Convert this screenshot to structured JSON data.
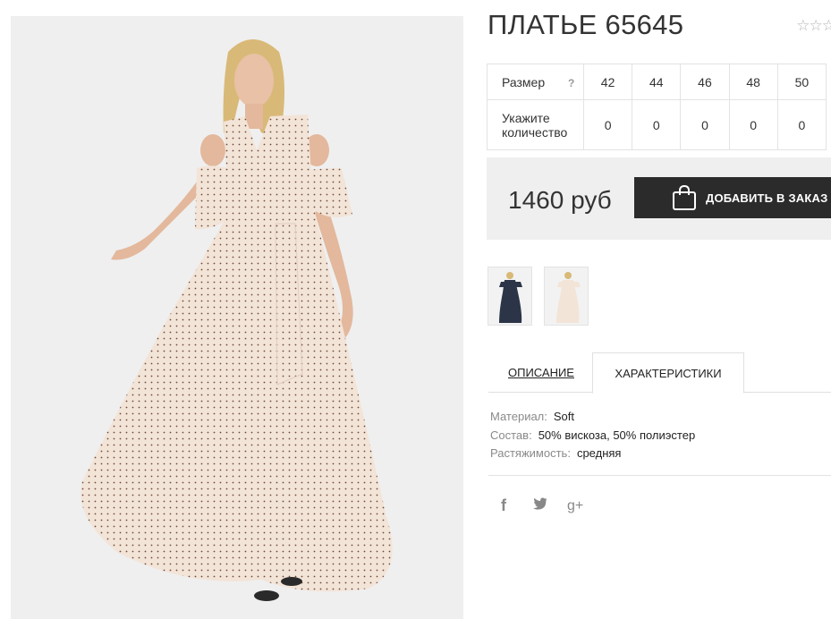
{
  "product": {
    "title": "ПЛАТЬЕ 65645",
    "rating_stars": "☆☆☆"
  },
  "size_table": {
    "size_label": "Размер",
    "help_mark": "?",
    "qty_label_line1": "Укажите",
    "qty_label_line2": "количество",
    "sizes": [
      "42",
      "44",
      "46",
      "48",
      "50"
    ],
    "quantities": [
      "0",
      "0",
      "0",
      "0",
      "0"
    ]
  },
  "purchase": {
    "price": "1460 руб",
    "add_to_cart_label": "ДОБАВИТЬ В ЗАКАЗ"
  },
  "tabs": {
    "description": "ОПИСАНИЕ",
    "characteristics": "ХАРАКТЕРИСТИКИ",
    "active": "characteristics"
  },
  "specs": [
    {
      "key": "Материал:",
      "value": "Soft"
    },
    {
      "key": "Состав:",
      "value": "50% вискоза, 50% полиэстер"
    },
    {
      "key": "Растяжимость:",
      "value": "средняя"
    }
  ],
  "share": {
    "facebook_glyph": "f",
    "google_glyph": "g+"
  },
  "colors": {
    "accent_dark": "#2b2b2b",
    "panel_grey": "#efefef",
    "dress_main": "#f3e4d8",
    "dress_alt": "#2c3448"
  }
}
